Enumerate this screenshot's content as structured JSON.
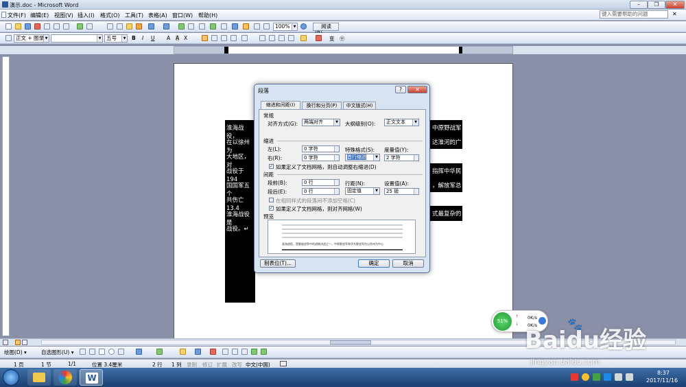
{
  "window": {
    "title": "演示.doc - Microsoft Word",
    "help_placeholder": "键入需要帮助的问题"
  },
  "menu": [
    "文件(F)",
    "编辑(E)",
    "视图(V)",
    "插入(I)",
    "格式(O)",
    "工具(T)",
    "表格(A)",
    "窗口(W)",
    "帮助(H)"
  ],
  "toolbar": {
    "zoom": "100%",
    "read_label": "阅读(R)",
    "style": "正文 + 图录",
    "font": "",
    "size": "五号"
  },
  "document": {
    "lines_left": [
      "淮海战役，",
      "在以徐州为",
      "大地区，对",
      "战役于 194",
      "国国军五个",
      "共伤亡 13.4",
      "淮海战役是",
      "战役。↵"
    ],
    "lines_right": [
      "中原野战军",
      "达淮河的广",
      "",
      "指挥中华民",
      "，解放军总",
      "",
      "式最复杂的"
    ]
  },
  "dialog": {
    "title": "段落",
    "tabs": [
      "缩进和间距(I)",
      "换行和分页(P)",
      "中文版式(H)"
    ],
    "general_heading": "常规",
    "alignment_label": "对齐方式(G):",
    "alignment_value": "两端对齐",
    "outline_label": "大纲级别(O):",
    "outline_value": "正文文本",
    "indent_heading": "缩进",
    "left_label": "左(L):",
    "left_value": "0 字符",
    "right_label": "右(R):",
    "right_value": "0 字符",
    "special_label": "特殊格式(S):",
    "special_value": "首行缩进",
    "measure_label": "度量值(Y):",
    "measure_value": "2 字符",
    "auto_indent_label": "如果定义了文档网格，则自动调整右缩进(D)",
    "spacing_heading": "间距",
    "before_label": "段前(B):",
    "before_value": "0 行",
    "after_label": "段后(E):",
    "after_value": "0 行",
    "line_label": "行距(N):",
    "line_value": "固定值",
    "setting_label": "设置值(A):",
    "setting_value": "25 磅",
    "no_space_label": "在相同样式的段落间不添加空格(C)",
    "snap_grid_label": "如果定义了文档网格，则对齐网格(W)",
    "preview_heading": "预览",
    "preview_sample": "淮海战役，是解放战争中的战略决战之一，中原野战军和华东野战军在以徐州为中心",
    "tabs_button": "制表位(T)...",
    "ok_button": "确定",
    "cancel_button": "取消"
  },
  "status": {
    "page": "1 页",
    "section": "1 节",
    "pages": "1/1",
    "position": "位置 3.4厘米",
    "line": "2 行",
    "col": "1 列",
    "rec": "录制",
    "trk": "修订",
    "ext": "扩展",
    "ovr": "改写",
    "lang": "中文(中国)"
  },
  "netwidget": {
    "percent": "51%",
    "up": "0K/s",
    "down": "0K/s"
  },
  "taskbar": {
    "time": "8:37",
    "date": "2017/11/16"
  },
  "watermark": {
    "main": "Baidu经验",
    "sub": "jingyan.baidu.com"
  }
}
